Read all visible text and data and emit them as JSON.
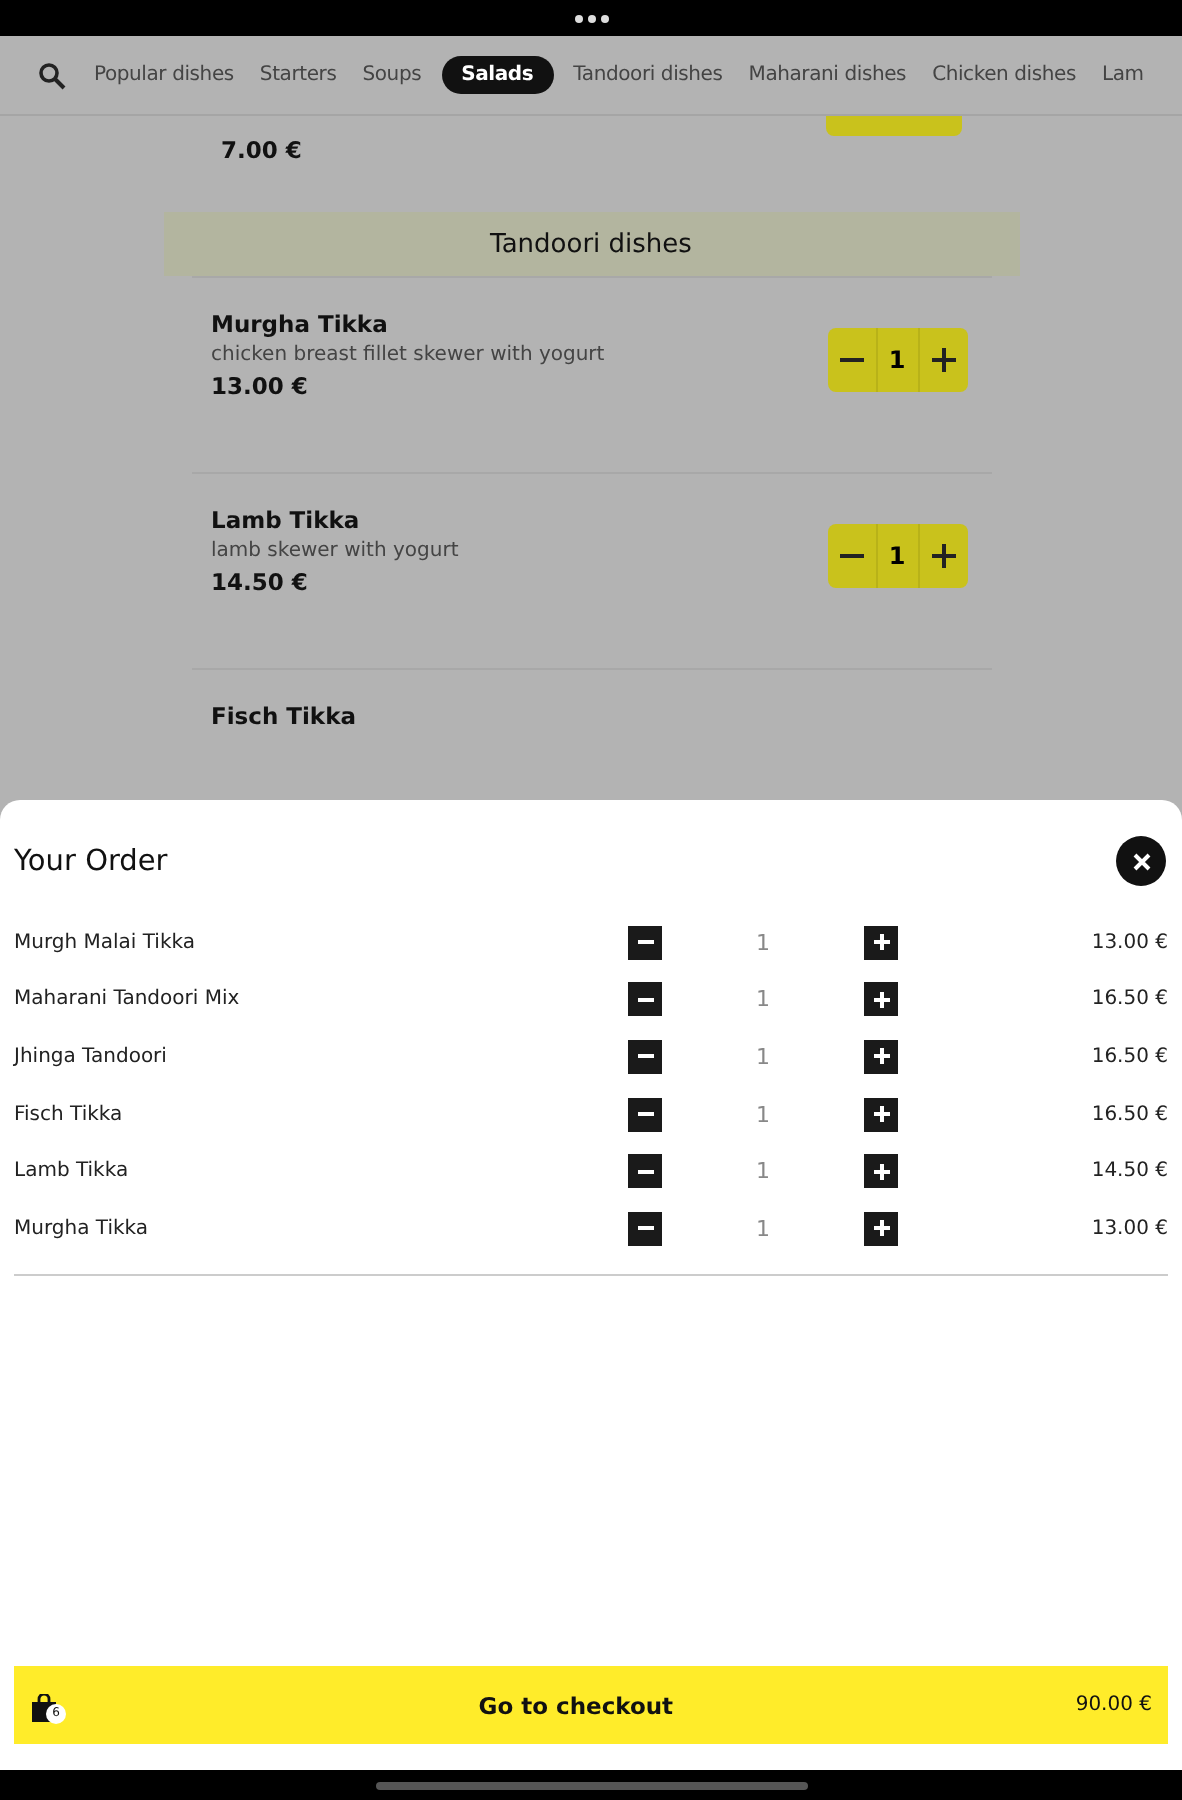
{
  "tabs": [
    {
      "label": "Popular dishes",
      "selected": false
    },
    {
      "label": "Starters",
      "selected": false
    },
    {
      "label": "Soups",
      "selected": false
    },
    {
      "label": "Salads",
      "selected": true
    },
    {
      "label": "Tandoori dishes",
      "selected": false
    },
    {
      "label": "Maharani dishes",
      "selected": false
    },
    {
      "label": "Chicken dishes",
      "selected": false
    },
    {
      "label": "Lam",
      "selected": false
    }
  ],
  "menu": {
    "cut_item": {
      "price": "7.00 €"
    },
    "section": {
      "title": "Tandoori dishes"
    },
    "items": [
      {
        "name": "Murgha Tikka",
        "description": "chicken breast fillet skewer with yogurt",
        "price": "13.00 €",
        "quantity": "1"
      },
      {
        "name": "Lamb Tikka",
        "description": "lamb skewer with yogurt",
        "price": "14.50 €",
        "quantity": "1"
      },
      {
        "name": "Fisch Tikka"
      }
    ]
  },
  "order": {
    "title": "Your Order",
    "lines": [
      {
        "name": "Murgh Malai Tikka",
        "quantity": "1",
        "price": "13.00 €"
      },
      {
        "name": "Maharani Tandoori Mix",
        "quantity": "1",
        "price": "16.50 €"
      },
      {
        "name": "Jhinga Tandoori",
        "quantity": "1",
        "price": "16.50 €"
      },
      {
        "name": "Fisch Tikka",
        "quantity": "1",
        "price": "16.50 €"
      },
      {
        "name": "Lamb Tikka",
        "quantity": "1",
        "price": "14.50 €"
      },
      {
        "name": "Murgha Tikka",
        "quantity": "1",
        "price": "13.00 €"
      }
    ],
    "checkout": {
      "label": "Go to checkout",
      "count": "6",
      "total": "90.00 €"
    }
  }
}
